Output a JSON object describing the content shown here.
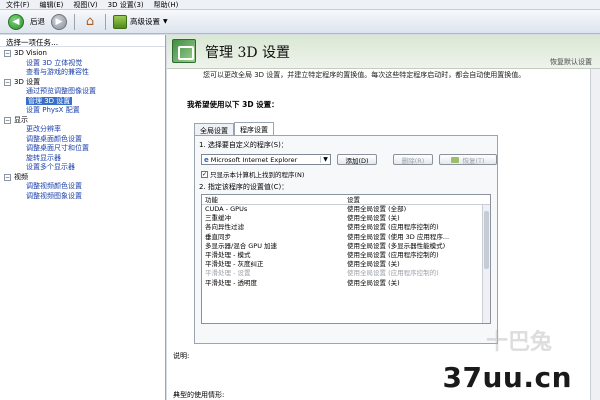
{
  "menubar": {
    "items": [
      "文件(F)",
      "编辑(E)",
      "视图(V)",
      "3D 设置(3)",
      "帮助(H)"
    ]
  },
  "toolbar": {
    "back_label": "后退",
    "settings_label": "高级设置"
  },
  "left_panel": {
    "header": "选择一项任务...",
    "tree": [
      {
        "label": "3D Vision",
        "items": [
          {
            "label": "设置 3D 立体视觉",
            "selected": false
          },
          {
            "label": "查看与游戏的兼容性",
            "selected": false
          }
        ]
      },
      {
        "label": "3D 设置",
        "items": [
          {
            "label": "通过预览调整图像设置",
            "selected": false
          },
          {
            "label": "管理 3D 设置",
            "selected": true
          },
          {
            "label": "设置 PhysX 配置",
            "selected": false
          }
        ]
      },
      {
        "label": "显示",
        "items": [
          {
            "label": "更改分辨率",
            "selected": false
          },
          {
            "label": "调整桌面颜色设置",
            "selected": false
          },
          {
            "label": "调整桌面尺寸和位置",
            "selected": false
          },
          {
            "label": "旋转显示器",
            "selected": false
          },
          {
            "label": "设置多个显示器",
            "selected": false
          }
        ]
      },
      {
        "label": "视频",
        "items": [
          {
            "label": "调整视频颜色设置",
            "selected": false
          },
          {
            "label": "调整视频图象设置",
            "selected": false
          }
        ]
      }
    ]
  },
  "main": {
    "title": "管理 3D 设置",
    "restore_defaults": "恢复默认设置",
    "description": "您可以更改全局 3D 设置，并建立特定程序的置换值。每次这些特定程序启动时，都会自动使用置换值。",
    "group_label": "我希望使用以下 3D 设置：",
    "tabs": [
      {
        "label": "全局设置",
        "active": false
      },
      {
        "label": "程序设置",
        "active": true
      }
    ],
    "step1": "1. 选择要自定义的程序(S)：",
    "program_selected": "Microsoft Internet Explorer",
    "add_button": "添加(D)",
    "delete_button": "删除(R)",
    "restore_button": "恢复(T)",
    "only_show_checkbox": "只显示本计算机上找到的程序(N)",
    "only_show_checked": true,
    "step2": "2. 指定该程序的设置值(C)：",
    "table": {
      "headers": [
        "功能",
        "设置"
      ],
      "rows": [
        {
          "feature": "CUDA - GPUs",
          "setting": "使用全局设置 (全部)",
          "faded": false
        },
        {
          "feature": "三重缓冲",
          "setting": "使用全局设置 (关)",
          "faded": false
        },
        {
          "feature": "各向异性过滤",
          "setting": "使用全局设置 (应用程序控制的)",
          "faded": false
        },
        {
          "feature": "垂直同步",
          "setting": "使用全局设置 (使用 3D 应用程序...",
          "faded": false
        },
        {
          "feature": "多显示器/混合 GPU 加速",
          "setting": "使用全局设置 (多显示器性能模式)",
          "faded": false
        },
        {
          "feature": "平滑处理 - 模式",
          "setting": "使用全局设置 (应用程序控制的)",
          "faded": false
        },
        {
          "feature": "平滑处理 - 灰度纠正",
          "setting": "使用全局设置 (关)",
          "faded": false
        },
        {
          "feature": "平滑处理 - 设置",
          "setting": "使用全局设置 (应用程序控制的)",
          "faded": true
        },
        {
          "feature": "平滑处理 - 透明度",
          "setting": "使用全局设置 (关)",
          "faded": false
        }
      ]
    },
    "description_label": "说明:",
    "typical_usage_label": "典型的使用情形:"
  },
  "watermark": {
    "main": "37uu.cn",
    "faded": "十巴兔"
  }
}
